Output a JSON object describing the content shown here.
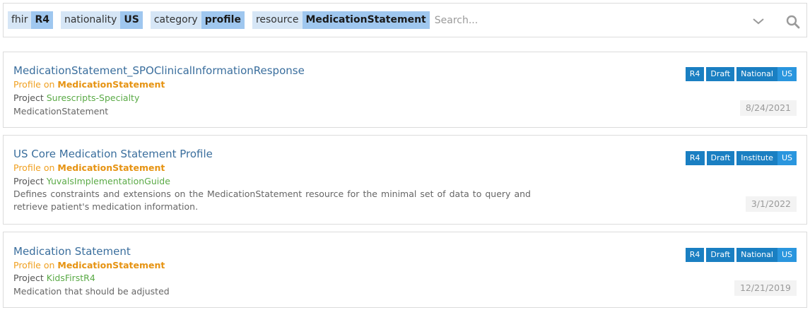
{
  "filters": [
    {
      "key": "fhir",
      "value": "R4"
    },
    {
      "key": "nationality",
      "value": "US"
    },
    {
      "key": "category",
      "value": "profile"
    },
    {
      "key": "resource",
      "value": "MedicationStatement"
    }
  ],
  "search": {
    "placeholder": "Search...",
    "value": ""
  },
  "icons": {
    "dropdown": "chevron-down-icon",
    "search": "search-icon"
  },
  "colors": {
    "accent_link": "#3a6e9d",
    "orange": "#e69312",
    "green": "#5aaa46",
    "badge_blue": "#1a7fc2"
  },
  "results": [
    {
      "title": "MedicationStatement_SPOClinicalInformationResponse",
      "profile_prefix": "Profile on ",
      "profile_resource": "MedicationStatement",
      "project_prefix": "Project ",
      "project_name": "Surescripts-Specialty",
      "description": "MedicationStatement",
      "badges": {
        "version": "R4",
        "status": "Draft",
        "scope": "National",
        "country": "US"
      },
      "date": "8/24/2021"
    },
    {
      "title": "US Core Medication Statement Profile",
      "profile_prefix": "Profile on ",
      "profile_resource": "MedicationStatement",
      "project_prefix": "Project ",
      "project_name": "YuvalsImplementationGuide",
      "description": "Defines constraints and extensions on the MedicationStatement resource for the minimal set of data to query and retrieve patient's medication information.",
      "badges": {
        "version": "R4",
        "status": "Draft",
        "scope": "Institute",
        "country": "US"
      },
      "date": "3/1/2022"
    },
    {
      "title": "Medication Statement",
      "profile_prefix": "Profile on ",
      "profile_resource": "MedicationStatement",
      "project_prefix": "Project ",
      "project_name": "KidsFirstR4",
      "description": "Medication that should be adjusted",
      "badges": {
        "version": "R4",
        "status": "Draft",
        "scope": "National",
        "country": "US"
      },
      "date": "12/21/2019"
    }
  ]
}
